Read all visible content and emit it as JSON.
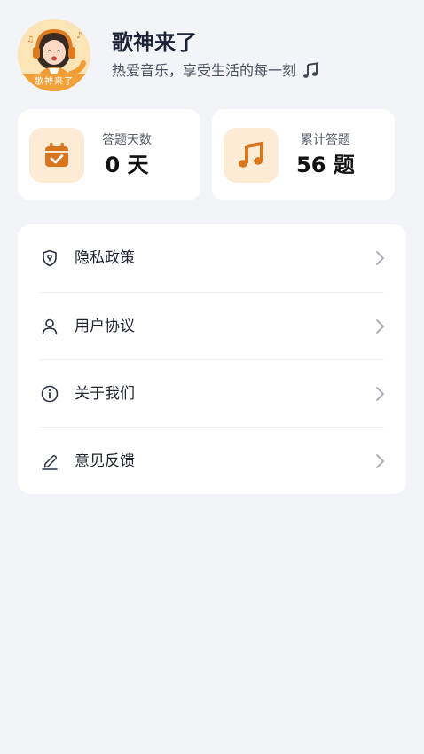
{
  "profile": {
    "app_name": "歌神来了",
    "slogan": "热爱音乐，享受生活的每一刻",
    "avatar_badge": "歌神来了",
    "slogan_icon": "music-note-icon"
  },
  "stats": [
    {
      "label": "答题天数",
      "value": "0 天",
      "icon": "calendar-check-icon"
    },
    {
      "label": "累计答题",
      "value": "56 题",
      "icon": "music-note-icon"
    }
  ],
  "menu": [
    {
      "label": "隐私政策",
      "icon": "shield-lock-icon"
    },
    {
      "label": "用户协议",
      "icon": "user-icon"
    },
    {
      "label": "关于我们",
      "icon": "info-icon"
    },
    {
      "label": "意见反馈",
      "icon": "edit-pen-icon"
    }
  ],
  "colors": {
    "background": "#f2f4f8",
    "card": "#ffffff",
    "accent_orange": "#d9751c",
    "icon_bg": "#fdebd5"
  }
}
